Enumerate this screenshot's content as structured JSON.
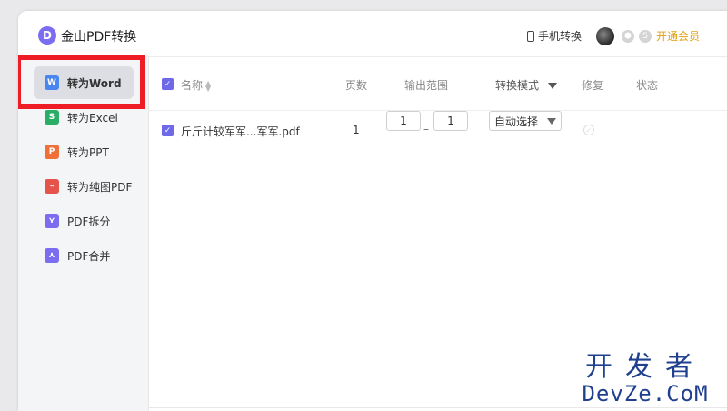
{
  "app": {
    "logo_letter": "D",
    "title": "金山PDF转换"
  },
  "header": {
    "mobile_label": "手机转换",
    "vip_label": "开通会员",
    "accent": "#e0a215"
  },
  "sidebar": {
    "items": [
      {
        "label": "转为Word",
        "icon_letter": "W",
        "color": "#4a86f0",
        "active": true
      },
      {
        "label": "转为Excel",
        "icon_letter": "S",
        "color": "#2aae67"
      },
      {
        "label": "转为PPT",
        "icon_letter": "P",
        "color": "#f0703a"
      },
      {
        "label": "转为纯图PDF",
        "icon_letter": "⌁",
        "color": "#e5534b"
      },
      {
        "label": "PDF拆分",
        "icon_letter": "⋎",
        "color": "#7b6cf0"
      },
      {
        "label": "PDF合并",
        "icon_letter": "⋏",
        "color": "#7b6cf0"
      }
    ]
  },
  "table": {
    "headers": {
      "name": "名称",
      "pages": "页数",
      "range": "输出范围",
      "mode": "转换模式",
      "repair": "修复",
      "status": "状态"
    },
    "rows": [
      {
        "name": "斤斤计较军军...军军.pdf",
        "pages": "1",
        "range_from": "1",
        "range_sep": "–",
        "range_to": "1",
        "mode": "自动选择"
      }
    ]
  },
  "watermark": {
    "top": "开发者",
    "bottom": "DevZe.CoM"
  }
}
